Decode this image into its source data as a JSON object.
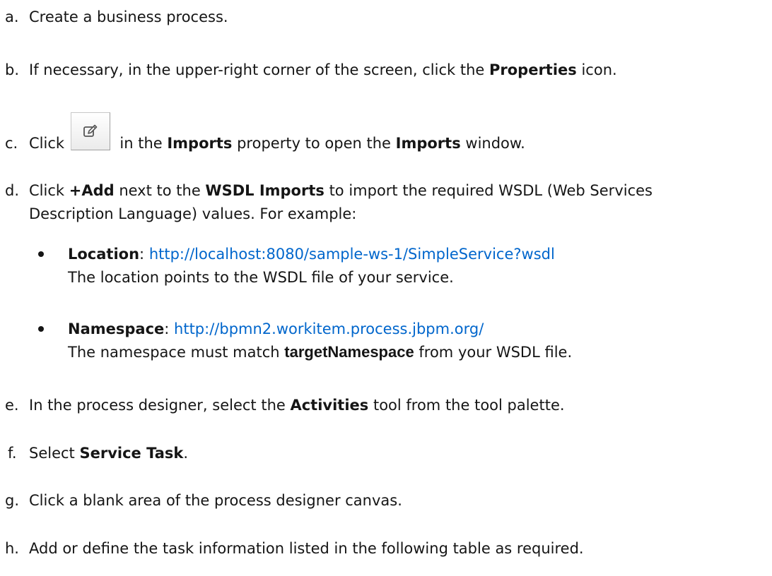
{
  "steps": {
    "a": {
      "letter": "a.",
      "text": "Create a business process."
    },
    "b": {
      "letter": "b.",
      "pre": "If necessary, in the upper-right corner of the screen, click the ",
      "bold": "Properties",
      "post": " icon."
    },
    "c": {
      "letter": "c.",
      "pre": "Click ",
      "mid1": " in the ",
      "bold1": "Imports",
      "mid2": " property to open the  ",
      "bold2": "Imports",
      "post": " window.",
      "icon": "edit-icon"
    },
    "d": {
      "letter": "d.",
      "pre": "Click ",
      "bold1": "+Add",
      "mid": " next to the  ",
      "bold2": "WSDL Imports",
      "post": " to import the required WSDL (Web Services",
      "line2": "Description Language) values. For example:"
    },
    "location": {
      "label": "Location",
      "sep": ": ",
      "link": "http://localhost:8080/sample-ws-1/SimpleService?wsdl",
      "desc": "The location points to the WSDL file of your service."
    },
    "namespace": {
      "label": "Namespace",
      "sep": ": ",
      "link": "http://bpmn2.workitem.process.jbpm.org/",
      "desc_pre": "The namespace must match ",
      "desc_bold": "targetNamespace",
      "desc_post": " from your WSDL file."
    },
    "e": {
      "letter": "e.",
      "pre": "In the process designer, select the ",
      "bold": "Activities",
      "post": " tool from the tool palette."
    },
    "f": {
      "letter": "f.",
      "pre": "Select ",
      "bold": "Service Task",
      "post": "."
    },
    "g": {
      "letter": "g.",
      "text": "Click a blank area of the process designer canvas."
    },
    "h": {
      "letter": "h.",
      "text": "Add or define the task information listed in the following table as required."
    }
  }
}
